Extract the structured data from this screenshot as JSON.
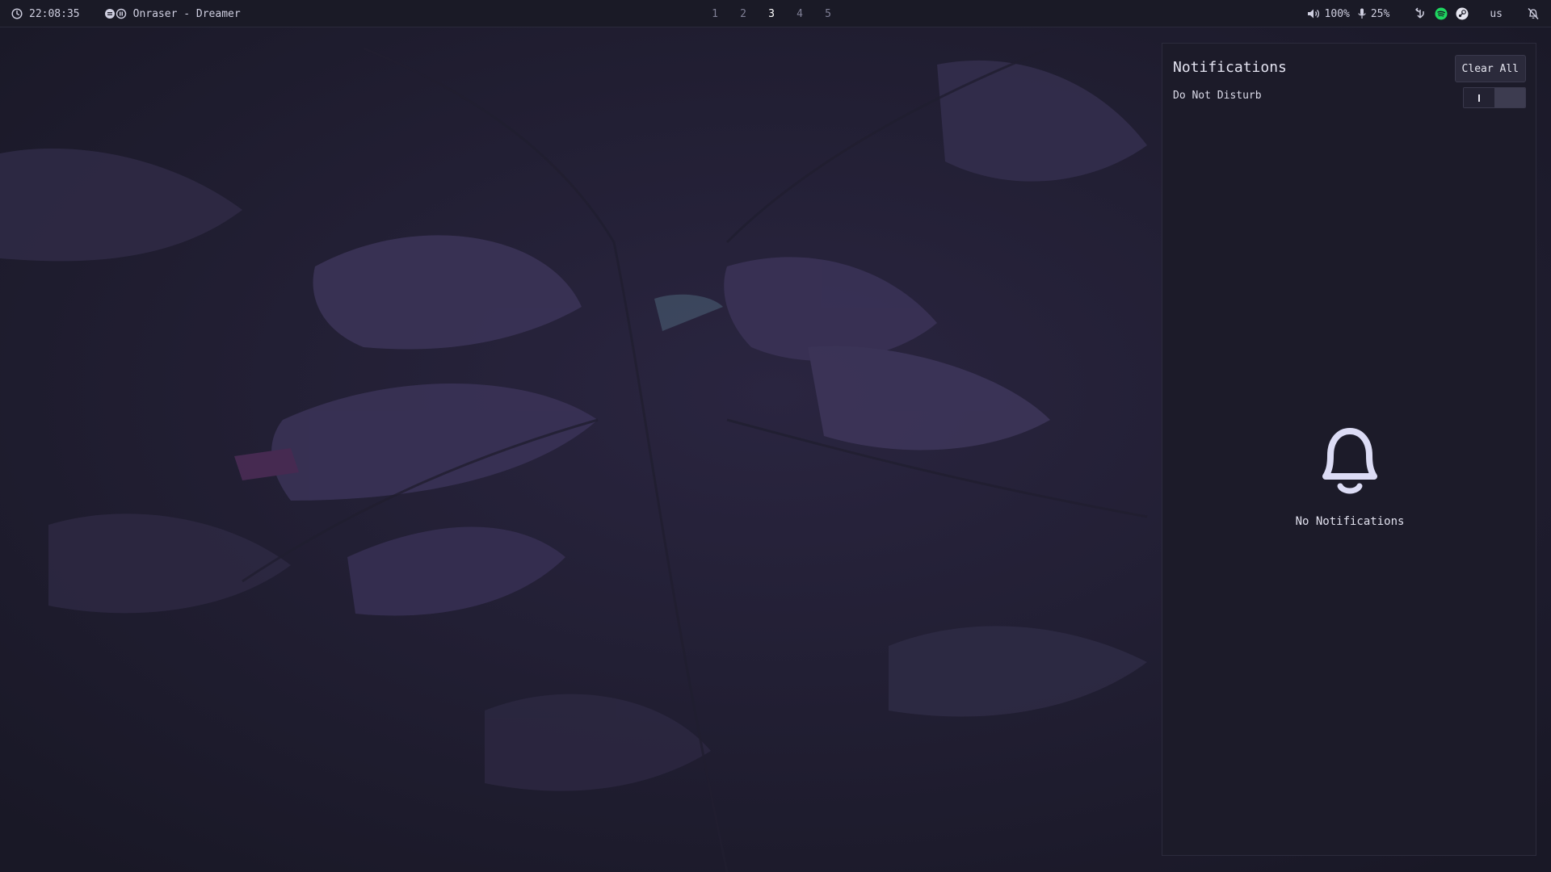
{
  "topbar": {
    "clock": "22:08:35",
    "media": "Onraser - Dreamer",
    "workspaces": [
      {
        "label": "1",
        "active": false
      },
      {
        "label": "2",
        "active": false
      },
      {
        "label": "3",
        "active": true
      },
      {
        "label": "4",
        "active": false
      },
      {
        "label": "5",
        "active": false
      }
    ],
    "volume": "100%",
    "mic": "25%",
    "keyboard_layout": "us",
    "icons": {
      "clock": "clock-icon",
      "media": "media-player-icon",
      "volume": "speaker-icon",
      "mic": "microphone-icon",
      "tray": [
        "network-icon",
        "spotify-icon",
        "steam-icon"
      ],
      "notifications": "bell-off-icon"
    }
  },
  "panel": {
    "title": "Notifications",
    "clear_label": "Clear All",
    "dnd_label": "Do Not Disturb",
    "dnd_enabled": false,
    "empty_text": "No Notifications"
  },
  "colors": {
    "bar_bg": "#1a1a26",
    "panel_bg": "#1c1b29",
    "accent": "#dcdcf5",
    "spotify": "#1ed760"
  }
}
